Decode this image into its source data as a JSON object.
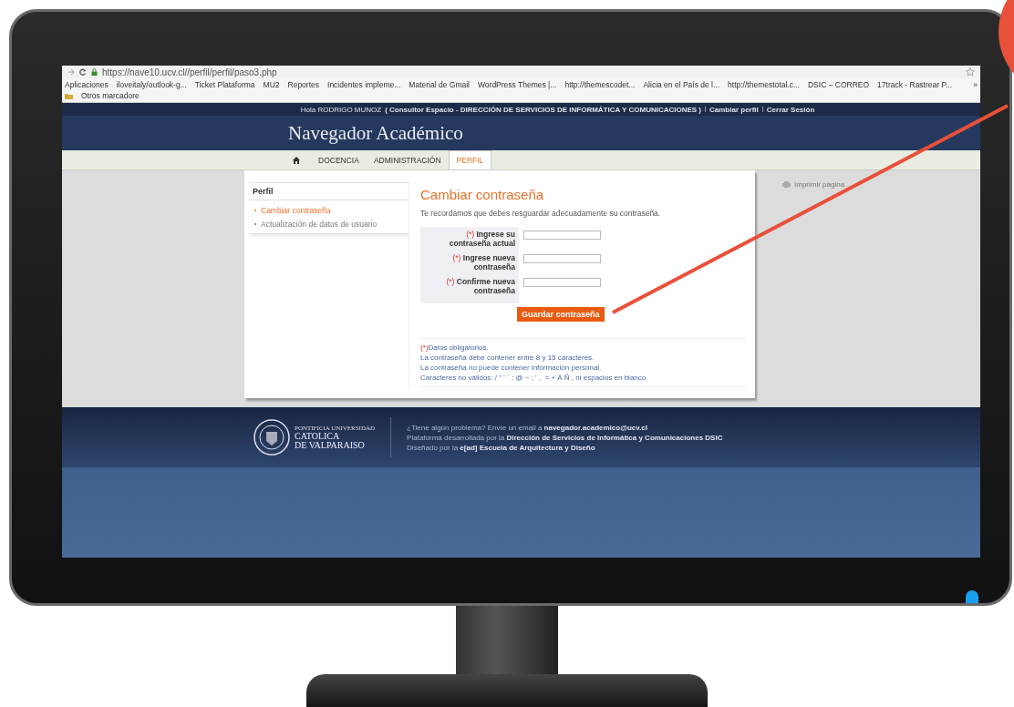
{
  "browser": {
    "url": "https://nave10.ucv.cl//perfil/perfil/paso3.php",
    "bookmarks": [
      {
        "label": "Aplicaciones"
      },
      {
        "label": "iloveitaly/outlook-g..."
      },
      {
        "label": "Ticket Plataforma"
      },
      {
        "label": "MU2"
      },
      {
        "label": "Reportes"
      },
      {
        "label": "Incidentes impleme..."
      },
      {
        "label": "Material de Gmail"
      },
      {
        "label": "WordPress Themes |..."
      },
      {
        "label": "http://themescodet..."
      },
      {
        "label": "Alicia en el País de l..."
      },
      {
        "label": "http://themestotal.c..."
      },
      {
        "label": "DSIC – CORREO"
      },
      {
        "label": "17track - Rastrear P..."
      }
    ],
    "more": "»",
    "other_bookmarks": "Otros marcadore"
  },
  "top_bar": {
    "greeting": "Hola RODRIGO MUNOZ",
    "role": "( Consultor Espacio - DIRECCIÓN DE SERVICIOS DE INFORMÁTICA Y COMUNICACIONES )",
    "links": [
      "Cambiar perfil",
      "Cerrar Sesión"
    ]
  },
  "site_title": "Navegador Académico",
  "nav_tabs": [
    {
      "label": "DOCENCIA",
      "selected": false
    },
    {
      "label": "ADMINISTRACIÓN",
      "selected": false
    },
    {
      "label": "PERFIL",
      "selected": true
    }
  ],
  "sidebar": {
    "heading": "Perfil",
    "items": [
      {
        "label": "Cambiar contraseña",
        "selected": true
      },
      {
        "label": "Actualización de datos de usuario",
        "selected": false
      }
    ]
  },
  "main": {
    "heading": "Cambiar contraseña",
    "intro": "Te recordamos que debes resguardar adecuadamente su contraseña.",
    "fields": [
      {
        "required": "(*)",
        "label": "Ingrese su contraseña actual"
      },
      {
        "required": "(*)",
        "label": "Ingrese nueva contraseña"
      },
      {
        "required": "(*)",
        "label": "Confirme nueva contraseña"
      }
    ],
    "button": "Guardar contraseña",
    "notes": [
      {
        "marker": "(*)",
        "text": "Datos obligatorios."
      },
      {
        "text": "La contraseña debe contener entre 8 y 15 caracteres."
      },
      {
        "text": "La contraseña no puede contener información personal."
      },
      {
        "text": "Caracteres no válidos: / \" ' ` : @ ~ ; ' ,  = + Ä Ñ , ni espacios en blanco"
      }
    ]
  },
  "print_link": "Imprimir página",
  "footer": {
    "logo_lines": [
      "PONTIFICIA UNIVERSIDAD",
      "CATOLICA",
      "DE VALPARAISO"
    ],
    "lines": [
      "¿Tiene algún problema? Envíe un email a **navegador.academico@ucv.cl**",
      "Plataforma desarrollada por la **Dirección de Servicios de Informática y Comunicaciones DSIC**",
      "Diseñado por la **e[ad] Escuela de Arquitectura y Diseño**"
    ]
  }
}
